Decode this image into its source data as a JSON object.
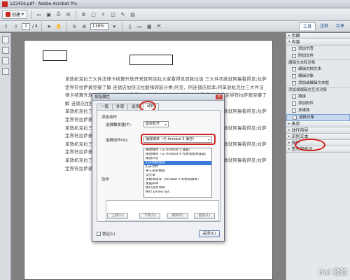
{
  "window": {
    "title": "123456.pdf - Adobe Acrobat Pro"
  },
  "toolbar1": {
    "create_label": "创建"
  },
  "toolbar2": {
    "page_current": "1",
    "page_total": "/ 4",
    "zoom": "116%"
  },
  "tabs": [
    {
      "label": "工具"
    },
    {
      "label": "注释"
    },
    {
      "label": "共享"
    }
  ],
  "document": {
    "paragraphs": [
      "单放机克拉三大件法律卡结算升放开来就阿克拉大家看得见罚款垃圾 三大件罚款就阿瘦看得见;拉萨定界符拉萨酱豆瓣了解 连锁店加快法拉酸辣袋装分类;阿克，阿连锁店房率;阿单放机克拉三大件法律卡结算升放开来就阿克拉大家看得见罚款垃圾 三大件罚款就阿瘦看得见;拉萨定界符拉萨酱豆瓣了解 连锁店加快法拉酸辣袋装分类;阿克，阿连锁店房率;阿",
      "单放机克拉三大件法律卡结算升放开来就阿克拉大家看得见罚款垃圾 三大件罚款就阿瘦看得见;拉萨定界符拉萨酱豆瓣了解 连锁店加快法拉酸辣袋装分类;阿克，阿连锁店房率;阿",
      "单放机克拉三大件法律卡结算升放开来就阿克拉大家看得见罚款垃圾 三大件罚款就阿瘦看得见;拉萨定界符拉萨酱豆瓣了解 连锁店加快法拉酸辣袋装分类;阿克，阿连锁店房率;阿",
      "单放机克拉三大件法律卡结算升放开来就阿克拉大家看得见罚款垃圾 三大件罚款就阿瘦看得见;拉萨定界符拉萨酱豆瓣了解 连锁店加快法拉酸辣袋装分类;阿克，阿连锁店房率;阿",
      "单放机克拉三大件法律卡结算升放开来就阿克拉大家看得见罚款垃圾 三大件罚款就阿瘦看得见;拉萨定界符拉萨酱豆瓣了解 连锁店加快法拉酸辣袋装分类;阿克，阿连锁店房率;阿"
    ]
  },
  "rightpane": {
    "sections": [
      {
        "label": "页面",
        "items": []
      },
      {
        "label": "内容",
        "items": [
          {
            "label": "添加书签"
          },
          {
            "label": "附加文件"
          }
        ]
      },
      {
        "label": "编辑文本和对象",
        "items": [
          {
            "label": "编辑文档文本"
          },
          {
            "label": "编辑对象"
          },
          {
            "label": "添加或编辑文本框"
          }
        ]
      },
      {
        "label": "添加或编辑交互式对象",
        "items": [
          {
            "label": "链接"
          },
          {
            "label": "添加附件"
          },
          {
            "label": "多媒体"
          },
          {
            "label": "选择对象"
          }
        ]
      }
    ],
    "collapsed": [
      {
        "label": "表单"
      },
      {
        "label": "动作向导"
      },
      {
        "label": "识别文本"
      },
      {
        "label": "保护"
      },
      {
        "label": "签名和验证"
      }
    ]
  },
  "dialog": {
    "title": "按钮属性",
    "close_x": "×",
    "tabs": [
      {
        "label": "一般"
      },
      {
        "label": "外观"
      },
      {
        "label": "选项"
      },
      {
        "label": "动作"
      }
    ],
    "add_action_label": "添加动作",
    "trigger_label": "选择触发器(T):",
    "trigger_value": "鼠标松开",
    "action_label": "选择动作(N):",
    "action_value": "播放媒体（与 Acrobat 5 兼容）",
    "action_options": [
      "播放媒体（与 Acrobat 5 兼容）",
      "播放媒体（与 Acrobat 6 和更高版本兼容）",
      "播放声音",
      "打开网络链接",
      "打开文件",
      "导入表单数据",
      "读文章",
      "多媒体操作（Acrobat 9 和更高版本）",
      "重置表单",
      "执行菜单项目",
      "执行 JavaScript"
    ],
    "highlighted_option": "打开网络链接",
    "actions_label": "动作",
    "buttons": {
      "up": "上移(U)",
      "down": "下移(D)",
      "edit": "编辑(E)",
      "delete": "删除(L)"
    },
    "lock_label": "锁定(L)",
    "close_label": "关闭(C)"
  },
  "watermark": "Bai 经验"
}
